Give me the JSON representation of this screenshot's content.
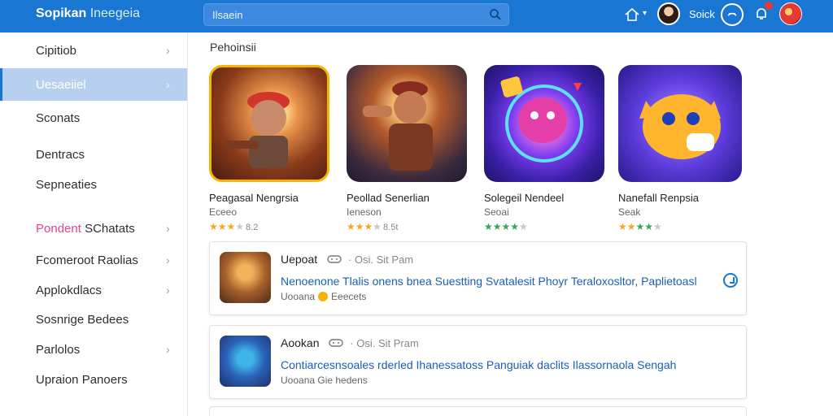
{
  "app": {
    "brand_bold": "Sopikan",
    "brand_sub": "Ineegeia"
  },
  "search": {
    "value": "Ilsaein"
  },
  "header": {
    "user_name": "Soick"
  },
  "sidebar": {
    "items": [
      {
        "label": "Cipitiob",
        "chevron": true,
        "active": false
      },
      {
        "label": "Uesaeiiel",
        "chevron": true,
        "active": true
      },
      {
        "label": "Sconats",
        "chevron": false,
        "active": false
      },
      {
        "label": "Dentracs",
        "chevron": false,
        "active": false
      },
      {
        "label": "Sepneaties",
        "chevron": false,
        "active": false
      },
      {
        "label_accent": "Pondent",
        "label": "SChatats",
        "chevron": true,
        "active": false
      },
      {
        "label": "Fcomeroot Raolias",
        "chevron": true,
        "active": false
      },
      {
        "label": "Applokdlacs",
        "chevron": true,
        "active": false
      },
      {
        "label": "Sosnrige Bedees",
        "chevron": false,
        "active": false
      },
      {
        "label": "Parlolos",
        "chevron": true,
        "active": false
      },
      {
        "label": "Upraion Panoers",
        "chevron": false,
        "active": false
      }
    ]
  },
  "main": {
    "section_title": "Pehoinsii",
    "featured": [
      {
        "name": "Peagasal Nengrsia",
        "sub": "Eceeo",
        "stars": 3,
        "star_color": "yellow",
        "rating": "8.2"
      },
      {
        "name": "Peollad Senerlian",
        "sub": "Ieneson",
        "stars": 3,
        "star_color": "yellow",
        "rating": "8.5t"
      },
      {
        "name": "Solegeil Nendeel",
        "sub": "Seoai",
        "stars": 4,
        "star_color": "green",
        "rating": ""
      },
      {
        "name": "Nanefall Renpsia",
        "sub": "Seak",
        "stars": 4,
        "star_color": "yellow",
        "rating": ""
      }
    ],
    "list": [
      {
        "title": "Uepoat",
        "meta": "Osi. Sit Pam",
        "desc": "Nenoenone Tlalis onens bnea Suestting Svatalesit Phoyr Teraloxosltor, Paplietoasl",
        "foot_a": "Uooana",
        "foot_b": "Eeecets",
        "coin": true
      },
      {
        "title": "Aookan",
        "meta": "Osi. Sit Pram",
        "desc": "Contiarcesnsoales rderled Ihanessatoss Panguiak daclits Ilassornaola Sengah",
        "foot_a": "Uooana Gie hedens",
        "foot_b": "",
        "coin": false
      }
    ]
  },
  "colors": {
    "topbar": "#1976d2",
    "active_item": "#b7d0f0",
    "link": "#1a5fb4",
    "star_yellow": "#f5a623",
    "star_green": "#34a853"
  }
}
